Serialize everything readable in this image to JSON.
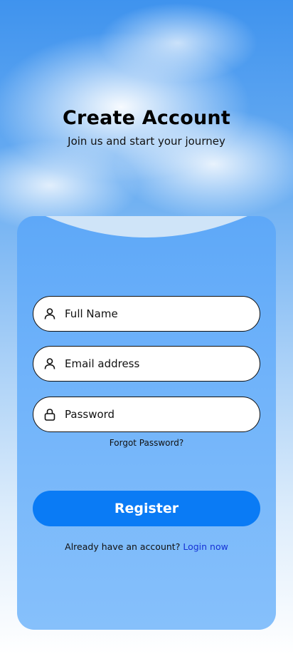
{
  "header": {
    "title": "Create Account",
    "subtitle": "Join us and start your journey"
  },
  "form": {
    "full_name": {
      "placeholder": "Full Name",
      "icon": "user-icon"
    },
    "email": {
      "placeholder": "Email address",
      "icon": "user-icon"
    },
    "password": {
      "placeholder": "Password",
      "icon": "lock-icon"
    },
    "forgot_label": "Forgot Password?",
    "register_label": "Register",
    "login_prompt": "Already have an account?",
    "login_link": "Login now"
  },
  "colors": {
    "card": "#70b3fa",
    "primary_button": "#0a7bf5",
    "link": "#1633d6"
  }
}
